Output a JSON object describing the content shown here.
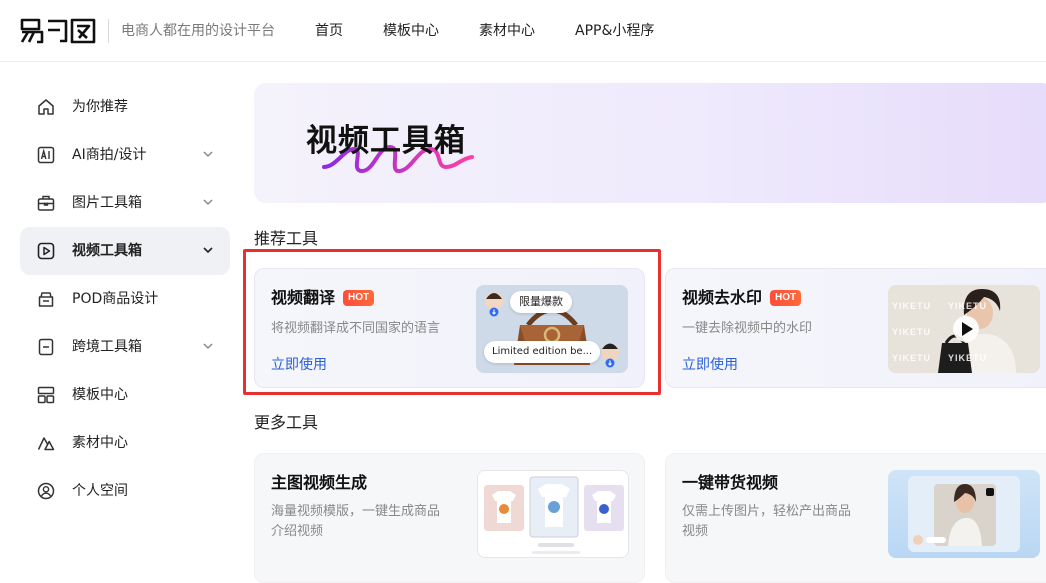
{
  "header": {
    "logo_text": "易可图",
    "slogan": "电商人都在用的设计平台",
    "nav": [
      "首页",
      "模板中心",
      "素材中心",
      "APP&小程序"
    ]
  },
  "sidebar": {
    "items": [
      {
        "label": "为你推荐",
        "icon": "home-icon",
        "expandable": false,
        "active": false
      },
      {
        "label": "AI商拍/设计",
        "icon": "ai-icon",
        "expandable": true,
        "active": false
      },
      {
        "label": "图片工具箱",
        "icon": "toolbox-icon",
        "expandable": true,
        "active": false
      },
      {
        "label": "视频工具箱",
        "icon": "video-play-icon",
        "expandable": true,
        "active": true
      },
      {
        "label": "POD商品设计",
        "icon": "pod-icon",
        "expandable": false,
        "active": false
      },
      {
        "label": "跨境工具箱",
        "icon": "cross-border-icon",
        "expandable": true,
        "active": false
      },
      {
        "label": "模板中心",
        "icon": "template-grid-icon",
        "expandable": false,
        "active": false
      },
      {
        "label": "素材中心",
        "icon": "shapes-icon",
        "expandable": false,
        "active": false
      },
      {
        "label": "个人空间",
        "icon": "user-icon",
        "expandable": false,
        "active": false
      }
    ]
  },
  "banner": {
    "title": "视频工具箱"
  },
  "sections": {
    "recommended": "推荐工具",
    "more": "更多工具"
  },
  "recommended_tools": [
    {
      "title": "视频翻译",
      "badge": "HOT",
      "desc": "将视频翻译成不同国家的语言",
      "link": "立即使用",
      "thumb": {
        "bubble_top": "限量爆款",
        "bubble_bottom": "Limited edition be..."
      }
    },
    {
      "title": "视频去水印",
      "badge": "HOT",
      "desc": "一键去除视频中的水印",
      "link": "立即使用",
      "thumb": {
        "watermark": "YIKETU"
      }
    }
  ],
  "more_tools": [
    {
      "title": "主图视频生成",
      "desc_line1": "海量视频模版，一键生成商品",
      "desc_line2": "介绍视频"
    },
    {
      "title": "一键带货视频",
      "desc_line1": "仅需上传图片，轻松产出商品",
      "desc_line2": "视频"
    }
  ],
  "colors": {
    "accent": "#2a5fd9",
    "hot": "#ff4d3a",
    "highlight": "#e8312e",
    "active_bg": "#f0f1f5"
  }
}
